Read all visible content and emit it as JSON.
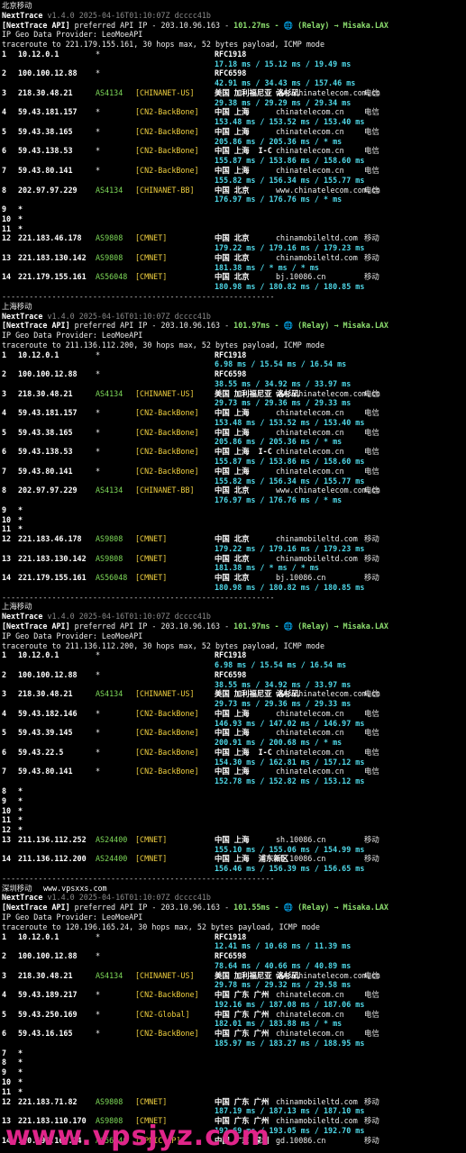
{
  "separator": "------------------------------------------------------------",
  "blocks": [
    {
      "title": "北京移动",
      "title_extra": "",
      "header": {
        "app": "NextTrace",
        "ver": "v1.4.0 2025-04-16T01:10:07Z dcccc41b"
      },
      "api_tag": "[NextTrace API]",
      "api_rest": " preferred API IP - 203.10.96.163 - ",
      "api_ms": "101.27ms",
      "api_tail": " - 🌐 (Relay) → Misaka.LAX",
      "geo": "IP Geo Data Provider: LeoMoeAPI",
      "trace": "traceroute to 221.179.155.161, 30 hops max, 52 bytes payload, ICMP mode",
      "hops": [
        {
          "n": "1",
          "ip": "10.12.0.1",
          "as": "*",
          "tag": "",
          "geo": "RFC1918",
          "domain": "",
          "isp": "",
          "rtt": "17.18 ms / 15.12 ms / 19.49 ms"
        },
        {
          "n": "2",
          "ip": "100.100.12.88",
          "as": "*",
          "tag": "",
          "geo": "RFC6598",
          "domain": "",
          "isp": "",
          "rtt": "42.91 ms / 34.43 ms / 157.46 ms"
        },
        {
          "n": "3",
          "ip": "218.30.48.21",
          "as": "AS4134",
          "tag": "[CHINANET-US]",
          "geo": "美国 加利福尼亚 洛杉矶",
          "domain": "www.chinatelecom.com.cn",
          "isp": "电信",
          "rtt": "29.38 ms / 29.29 ms / 29.34 ms"
        },
        {
          "n": "4",
          "ip": "59.43.181.157",
          "as": "*",
          "tag": "[CN2-BackBone]",
          "geo": "中国 上海",
          "domain": "chinatelecom.cn",
          "isp": "电信",
          "rtt": "153.48 ms / 153.52 ms / 153.40 ms"
        },
        {
          "n": "5",
          "ip": "59.43.38.165",
          "as": "*",
          "tag": "[CN2-BackBone]",
          "geo": "中国 上海",
          "domain": "chinatelecom.cn",
          "isp": "电信",
          "rtt": "205.86 ms / 205.36 ms / * ms"
        },
        {
          "n": "6",
          "ip": "59.43.138.53",
          "as": "*",
          "tag": "[CN2-BackBone]",
          "geo": "中国 上海  I-C",
          "domain": "chinatelecom.cn",
          "isp": "电信",
          "rtt": "155.87 ms / 153.86 ms / 158.60 ms"
        },
        {
          "n": "7",
          "ip": "59.43.80.141",
          "as": "*",
          "tag": "[CN2-BackBone]",
          "geo": "中国 上海",
          "domain": "chinatelecom.cn",
          "isp": "电信",
          "rtt": "155.82 ms / 156.34 ms / 155.77 ms"
        },
        {
          "n": "8",
          "ip": "202.97.97.229",
          "as": "AS4134",
          "tag": "[CHINANET-BB]",
          "geo": "中国 北京",
          "domain": "www.chinatelecom.com.cn",
          "isp": "电信",
          "rtt": "176.97 ms / 176.76 ms / * ms"
        },
        {
          "n": "9",
          "ip": "*"
        },
        {
          "n": "10",
          "ip": "*"
        },
        {
          "n": "11",
          "ip": "*"
        },
        {
          "n": "12",
          "ip": "221.183.46.178",
          "as": "AS9808",
          "tag": "[CMNET]",
          "geo": "中国 北京",
          "domain": "chinamobileltd.com",
          "isp": "移动",
          "rtt": "179.22 ms / 179.16 ms / 179.23 ms"
        },
        {
          "n": "13",
          "ip": "221.183.130.142",
          "as": "AS9808",
          "tag": "[CMNET]",
          "geo": "中国 北京",
          "domain": "chinamobileltd.com",
          "isp": "移动",
          "rtt": "181.38 ms / * ms / * ms"
        },
        {
          "n": "14",
          "ip": "221.179.155.161",
          "as": "AS56048",
          "tag": "[CMNET]",
          "geo": "中国 北京",
          "domain": "bj.10086.cn",
          "isp": "移动",
          "rtt": "180.98 ms / 180.82 ms / 180.85 ms"
        }
      ]
    },
    {
      "title": "上海移动",
      "title_extra": "",
      "header": {
        "app": "NextTrace",
        "ver": "v1.4.0 2025-04-16T01:10:07Z dcccc41b"
      },
      "api_tag": "[NextTrace API]",
      "api_rest": " preferred API IP - 203.10.96.163 - ",
      "api_ms": "101.97ms",
      "api_tail": " - 🌐 (Relay) → Misaka.LAX",
      "geo": "IP Geo Data Provider: LeoMoeAPI",
      "trace": "traceroute to 211.136.112.200, 30 hops max, 52 bytes payload, ICMP mode",
      "hops": [
        {
          "n": "1",
          "ip": "10.12.0.1",
          "as": "*",
          "tag": "",
          "geo": "RFC1918",
          "domain": "",
          "isp": "",
          "rtt": "6.98 ms / 15.54 ms / 16.54 ms"
        },
        {
          "n": "2",
          "ip": "100.100.12.88",
          "as": "*",
          "tag": "",
          "geo": "RFC6598",
          "domain": "",
          "isp": "",
          "rtt": "38.55 ms / 34.92 ms / 33.97 ms"
        },
        {
          "n": "3",
          "ip": "218.30.48.21",
          "as": "AS4134",
          "tag": "[CHINANET-US]",
          "geo": "美国 加利福尼亚 洛杉矶",
          "domain": "www.chinatelecom.com.cn",
          "isp": "电信",
          "rtt": "29.73 ms / 29.36 ms / 29.33 ms"
        },
        {
          "n": "4",
          "ip": "59.43.181.157",
          "as": "*",
          "tag": "[CN2-BackBone]",
          "geo": "中国 上海",
          "domain": "chinatelecom.cn",
          "isp": "电信",
          "rtt": "153.48 ms / 153.52 ms / 153.40 ms"
        },
        {
          "n": "5",
          "ip": "59.43.38.165",
          "as": "*",
          "tag": "[CN2-BackBone]",
          "geo": "中国 上海",
          "domain": "chinatelecom.cn",
          "isp": "电信",
          "rtt": "205.86 ms / 205.36 ms / * ms"
        },
        {
          "n": "6",
          "ip": "59.43.138.53",
          "as": "*",
          "tag": "[CN2-BackBone]",
          "geo": "中国 上海  I-C",
          "domain": "chinatelecom.cn",
          "isp": "电信",
          "rtt": "155.87 ms / 153.86 ms / 158.60 ms"
        },
        {
          "n": "7",
          "ip": "59.43.80.141",
          "as": "*",
          "tag": "[CN2-BackBone]",
          "geo": "中国 上海",
          "domain": "chinatelecom.cn",
          "isp": "电信",
          "rtt": "155.82 ms / 156.34 ms / 155.77 ms"
        },
        {
          "n": "8",
          "ip": "202.97.97.229",
          "as": "AS4134",
          "tag": "[CHINANET-BB]",
          "geo": "中国 北京",
          "domain": "www.chinatelecom.com.cn",
          "isp": "电信",
          "rtt": "176.97 ms / 176.76 ms / * ms"
        },
        {
          "n": "9",
          "ip": "*"
        },
        {
          "n": "10",
          "ip": "*"
        },
        {
          "n": "11",
          "ip": "*"
        },
        {
          "n": "12",
          "ip": "221.183.46.178",
          "as": "AS9808",
          "tag": "[CMNET]",
          "geo": "中国 北京",
          "domain": "chinamobileltd.com",
          "isp": "移动",
          "rtt": "179.22 ms / 179.16 ms / 179.23 ms"
        },
        {
          "n": "13",
          "ip": "221.183.130.142",
          "as": "AS9808",
          "tag": "[CMNET]",
          "geo": "中国 北京",
          "domain": "chinamobileltd.com",
          "isp": "移动",
          "rtt": "181.38 ms / * ms / * ms"
        },
        {
          "n": "14",
          "ip": "221.179.155.161",
          "as": "AS56048",
          "tag": "[CMNET]",
          "geo": "中国 北京",
          "domain": "bj.10086.cn",
          "isp": "移动",
          "rtt": "180.98 ms / 180.82 ms / 180.85 ms"
        }
      ]
    },
    {
      "title": "上海移动",
      "title_extra": "",
      "header": {
        "app": "NextTrace",
        "ver": "v1.4.0 2025-04-16T01:10:07Z dcccc41b"
      },
      "api_tag": "[NextTrace API]",
      "api_rest": " preferred API IP - 203.10.96.163 - ",
      "api_ms": "101.97ms",
      "api_tail": " - 🌐 (Relay) → Misaka.LAX",
      "geo": "IP Geo Data Provider: LeoMoeAPI",
      "trace": "traceroute to 211.136.112.200, 30 hops max, 52 bytes payload, ICMP mode",
      "hops": [
        {
          "n": "1",
          "ip": "10.12.0.1",
          "as": "*",
          "tag": "",
          "geo": "RFC1918",
          "domain": "",
          "isp": "",
          "rtt": "6.98 ms / 15.54 ms / 16.54 ms"
        },
        {
          "n": "2",
          "ip": "100.100.12.88",
          "as": "*",
          "tag": "",
          "geo": "RFC6598",
          "domain": "",
          "isp": "",
          "rtt": "38.55 ms / 34.92 ms / 33.97 ms"
        },
        {
          "n": "3",
          "ip": "218.30.48.21",
          "as": "AS4134",
          "tag": "[CHINANET-US]",
          "geo": "美国 加利福尼亚 洛杉矶",
          "domain": "www.chinatelecom.com.cn",
          "isp": "电信",
          "rtt": "29.73 ms / 29.36 ms / 29.33 ms"
        },
        {
          "n": "4",
          "ip": "59.43.182.146",
          "as": "*",
          "tag": "[CN2-BackBone]",
          "geo": "中国 上海",
          "domain": "chinatelecom.cn",
          "isp": "电信",
          "rtt": "146.93 ms / 147.02 ms / 146.97 ms"
        },
        {
          "n": "5",
          "ip": "59.43.39.145",
          "as": "*",
          "tag": "[CN2-BackBone]",
          "geo": "中国 上海",
          "domain": "chinatelecom.cn",
          "isp": "电信",
          "rtt": "200.91 ms / 200.68 ms / * ms"
        },
        {
          "n": "6",
          "ip": "59.43.22.5",
          "as": "*",
          "tag": "[CN2-BackBone]",
          "geo": "中国 上海  I-C",
          "domain": "chinatelecom.cn",
          "isp": "电信",
          "rtt": "154.30 ms / 162.81 ms / 157.12 ms"
        },
        {
          "n": "7",
          "ip": "59.43.80.141",
          "as": "*",
          "tag": "[CN2-BackBone]",
          "geo": "中国 上海",
          "domain": "chinatelecom.cn",
          "isp": "电信",
          "rtt": "152.78 ms / 152.82 ms / 153.12 ms"
        },
        {
          "n": "8",
          "ip": "*"
        },
        {
          "n": "9",
          "ip": "*"
        },
        {
          "n": "10",
          "ip": "*"
        },
        {
          "n": "11",
          "ip": "*"
        },
        {
          "n": "12",
          "ip": "*"
        },
        {
          "n": "13",
          "ip": "211.136.112.252",
          "as": "AS24400",
          "tag": "[CMNET]",
          "geo": "中国 上海",
          "domain": "sh.10086.cn",
          "isp": "移动",
          "rtt": "155.10 ms / 155.06 ms / 154.99 ms"
        },
        {
          "n": "14",
          "ip": "211.136.112.200",
          "as": "AS24400",
          "tag": "[CMNET]",
          "geo": "中国 上海  浦东新区",
          "domain": "sh.10086.cn",
          "isp": "移动",
          "rtt": "156.46 ms / 156.39 ms / 156.65 ms"
        }
      ]
    },
    {
      "title": "深圳移动",
      "title_extra": "www.vpsxxs.com",
      "header": {
        "app": "NextTrace",
        "ver": "v1.4.0 2025-04-16T01:10:07Z dcccc41b"
      },
      "api_tag": "[NextTrace API]",
      "api_rest": " preferred API IP - 203.10.96.163 - ",
      "api_ms": "101.55ms",
      "api_tail": " - 🌐 (Relay) → Misaka.LAX",
      "geo": "IP Geo Data Provider: LeoMoeAPI",
      "trace": "traceroute to 120.196.165.24, 30 hops max, 52 bytes payload, ICMP mode",
      "hops": [
        {
          "n": "1",
          "ip": "10.12.0.1",
          "as": "*",
          "tag": "",
          "geo": "RFC1918",
          "domain": "",
          "isp": "",
          "rtt": "12.41 ms / 10.68 ms / 11.39 ms"
        },
        {
          "n": "2",
          "ip": "100.100.12.88",
          "as": "*",
          "tag": "",
          "geo": "RFC6598",
          "domain": "",
          "isp": "",
          "rtt": "78.64 ms / 40.66 ms / 40.89 ms"
        },
        {
          "n": "3",
          "ip": "218.30.48.21",
          "as": "AS4134",
          "tag": "[CHINANET-US]",
          "geo": "美国 加利福尼亚 洛杉矶",
          "domain": "www.chinatelecom.com.cn",
          "isp": "电信",
          "rtt": "29.78 ms / 29.32 ms / 29.58 ms"
        },
        {
          "n": "4",
          "ip": "59.43.189.217",
          "as": "*",
          "tag": "[CN2-BackBone]",
          "geo": "中国 广东 广州",
          "domain": "chinatelecom.cn",
          "isp": "电信",
          "rtt": "192.16 ms / 187.08 ms / 187.06 ms"
        },
        {
          "n": "5",
          "ip": "59.43.250.169",
          "as": "*",
          "tag": "[CN2-Global]",
          "geo": "中国 广东 广州",
          "domain": "chinatelecom.cn",
          "isp": "电信",
          "rtt": "182.01 ms / 183.88 ms / * ms"
        },
        {
          "n": "6",
          "ip": "59.43.16.165",
          "as": "*",
          "tag": "[CN2-BackBone]",
          "geo": "中国 广东 广州",
          "domain": "chinatelecom.cn",
          "isp": "电信",
          "rtt": "185.97 ms / 183.27 ms / 188.95 ms"
        },
        {
          "n": "7",
          "ip": "*"
        },
        {
          "n": "8",
          "ip": "*"
        },
        {
          "n": "9",
          "ip": "*"
        },
        {
          "n": "10",
          "ip": "*"
        },
        {
          "n": "11",
          "ip": "*"
        },
        {
          "n": "12",
          "ip": "221.183.71.82",
          "as": "AS9808",
          "tag": "[CMNET]",
          "geo": "中国 广东 广州",
          "domain": "chinamobileltd.com",
          "isp": "移动",
          "rtt": "187.19 ms / 187.13 ms / 187.10 ms"
        },
        {
          "n": "13",
          "ip": "221.183.110.170",
          "as": "AS9808",
          "tag": "[CMNET]",
          "geo": "中国 广东 广州",
          "domain": "chinamobileltd.com",
          "isp": "移动",
          "rtt": "192.69 ms / 193.05 ms / 192.70 ms"
        },
        {
          "n": "14",
          "ip": "120.196.165.24",
          "as": "AS56040",
          "tag": "[APNIC-AP]",
          "geo": "中国 广东 深圳",
          "domain": "gd.10086.cn",
          "isp": "移动",
          "rtt": ""
        }
      ]
    }
  ],
  "watermark": "www.vpsjyz.com"
}
